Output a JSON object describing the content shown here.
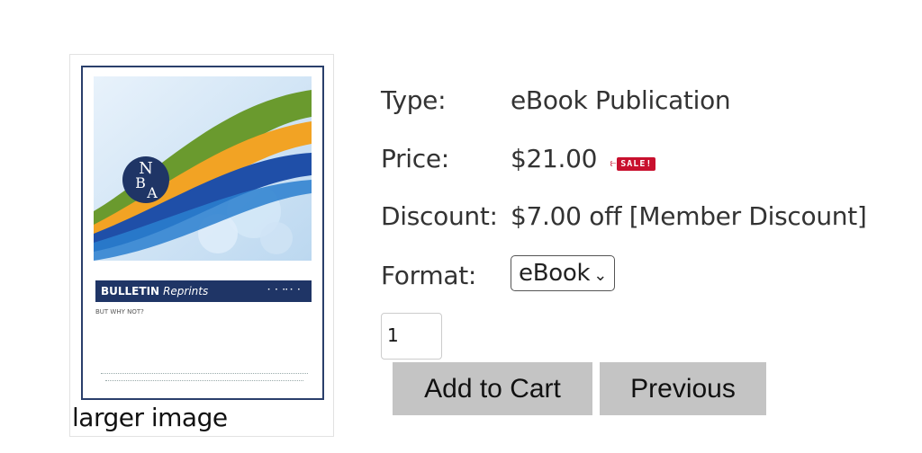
{
  "product": {
    "image": {
      "cover_banner_bold": "BULLETIN",
      "cover_banner_italic": "Reprints",
      "cover_subtitle": "BUT WHY NOT?",
      "logo_letters": "NBA",
      "larger_image_label": "larger image"
    },
    "details": {
      "type_label": "Type:",
      "type_value": "eBook Publication",
      "price_label": "Price:",
      "price_value": "$21.00",
      "sale_badge": "SALE!",
      "discount_label": "Discount:",
      "discount_value": "$7.00 off [Member Discount]",
      "format_label": "Format:",
      "format_selected": "eBook"
    },
    "quantity": "1",
    "buttons": {
      "add_to_cart": "Add to Cart",
      "previous": "Previous"
    }
  },
  "colors": {
    "button_bg": "#c4c4c4",
    "sale_red": "#c8102e",
    "cover_navy": "#1f3566"
  }
}
